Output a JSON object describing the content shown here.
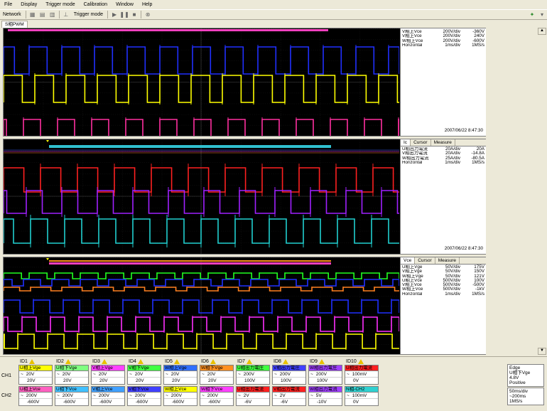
{
  "menu": [
    "File",
    "Display",
    "Trigger mode",
    "Calibration",
    "Window",
    "Help"
  ],
  "toolbar": {
    "network": "Network",
    "trigger_mode": "Trigger mode"
  },
  "doc_tab": "S相PWM",
  "panel1": {
    "rows": [
      {
        "name": "V相上Vce",
        "div": "200V/div",
        "val": "-360V"
      },
      {
        "name": "V相上Vce",
        "div": "200V/div",
        "val": "240V"
      },
      {
        "name": "W相上Vce",
        "div": "200V/div",
        "val": "-600V"
      },
      {
        "name": "Horizontal",
        "div": "1ms/div",
        "val": "1MS/s"
      }
    ],
    "timestamp": "2007/06/22 8:47:30"
  },
  "panel2": {
    "tabs": [
      "Ic",
      "Cursor",
      "Measure"
    ],
    "rows": [
      {
        "name": "U相出力電流",
        "div": "20A/div",
        "val": "20A"
      },
      {
        "name": "V相出力電流",
        "div": "20A/div",
        "val": "-14.8A"
      },
      {
        "name": "W相出力電流",
        "div": "25A/div",
        "val": "-80.5A"
      },
      {
        "name": "Horizontal",
        "div": "1ms/div",
        "val": "1MS/s"
      }
    ],
    "timestamp": "2007/06/22 8:47:30"
  },
  "panel3": {
    "tabs": [
      "Vce",
      "Cursor",
      "Measure"
    ],
    "rows": [
      {
        "name": "U相上Vge",
        "div": "50V/div",
        "val": "175V"
      },
      {
        "name": "V相上Vge",
        "div": "50V/div",
        "val": "150V"
      },
      {
        "name": "W相上Vge",
        "div": "50V/div",
        "val": "121V"
      },
      {
        "name": "U相上Vce",
        "div": "500V/div",
        "val": "100V"
      },
      {
        "name": "V相上Vce",
        "div": "500V/div",
        "val": "-500V"
      },
      {
        "name": "W相上Vce",
        "div": "500V/div",
        "val": "-1kV"
      },
      {
        "name": "Horizontal",
        "div": "1ms/div",
        "val": "1MS/s"
      }
    ]
  },
  "channels": {
    "ch1_label": "CH1",
    "ch2_label": "CH2",
    "ids": [
      "ID1",
      "ID2",
      "ID3",
      "ID4",
      "ID5",
      "ID6",
      "ID7",
      "ID8",
      "ID9",
      "ID10"
    ],
    "ch1": [
      {
        "name": "U相上Vge",
        "color": "#ffff00",
        "r1": "20V",
        "r2": "20V"
      },
      {
        "name": "U相下Vge",
        "color": "#80ff80",
        "r1": "20V",
        "r2": "20V"
      },
      {
        "name": "V相上Vge",
        "color": "#ff40ff",
        "r1": "20V",
        "r2": "20V"
      },
      {
        "name": "V相下Vge",
        "color": "#40ff40",
        "r1": "20V",
        "r2": "20V"
      },
      {
        "name": "W相上Vge",
        "color": "#3070ff",
        "r1": "20V",
        "r2": "20V"
      },
      {
        "name": "W相下Vge",
        "color": "#ff9020",
        "r1": "20V",
        "r2": "20V"
      },
      {
        "name": "U相出力電圧",
        "color": "#40ff40",
        "r1": "200V",
        "r2": "100V"
      },
      {
        "name": "V相出力電圧",
        "color": "#4040ff",
        "r1": "200V",
        "r2": "100V"
      },
      {
        "name": "W相出力電圧",
        "color": "#a040ff",
        "r1": "200V",
        "r2": "100V"
      },
      {
        "name": "U相出力電流",
        "color": "#ff2020",
        "r1": "100mV",
        "r2": "0V"
      }
    ],
    "ch2": [
      {
        "name": "U相上Vce",
        "color": "#ff60c0",
        "r1": "200V",
        "r2": "-600V"
      },
      {
        "name": "U相下Vce",
        "color": "#40c0ff",
        "r1": "200V",
        "r2": "-600V"
      },
      {
        "name": "V相上Vce",
        "color": "#40a0ff",
        "r1": "200V",
        "r2": "-600V"
      },
      {
        "name": "V相下Vce",
        "color": "#4040ff",
        "r1": "200V",
        "r2": "-600V"
      },
      {
        "name": "W相上Vce",
        "color": "#ffff00",
        "r1": "200V",
        "r2": "-600V"
      },
      {
        "name": "W相下Vce",
        "color": "#ff40ff",
        "r1": "200V",
        "r2": "-600V"
      },
      {
        "name": "U相出力電流",
        "color": "#ff2020",
        "r1": "2V",
        "r2": "-6V"
      },
      {
        "name": "V相出力電流",
        "color": "#ff2020",
        "r1": "2V",
        "r2": "-6V"
      },
      {
        "name": "W相出力電流",
        "color": "#a040ff",
        "r1": "5V",
        "r2": "-10V"
      },
      {
        "name": "N相-CH2",
        "color": "#30d0d0",
        "r1": "100mV",
        "r2": "0V"
      }
    ],
    "tilde": "~"
  },
  "trigger": {
    "line1": "Edge",
    "line2": "U相下Vge",
    "line3": "4.8V",
    "line4": "Positive"
  },
  "timebase": {
    "line1": "50ms/div",
    "line2": "~200ms",
    "line3": "1MS/s"
  }
}
